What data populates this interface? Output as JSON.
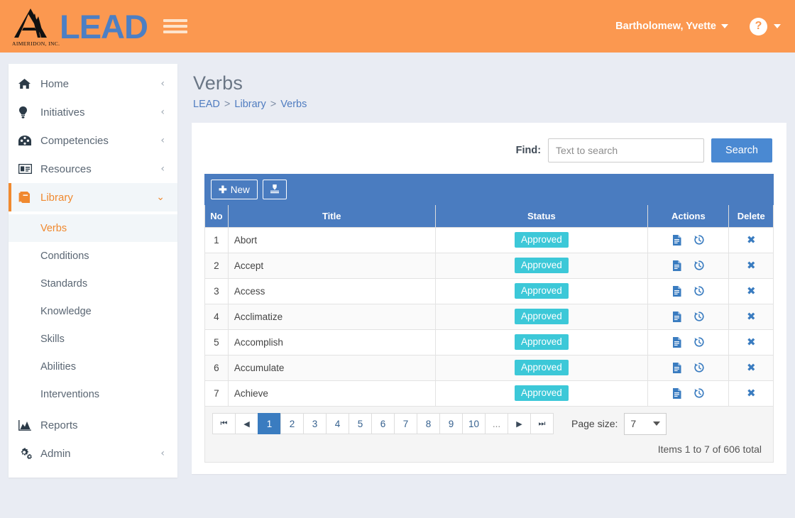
{
  "topbar": {
    "logo_word": "LEAD",
    "logo_sub": "AIMERIDON, INC.",
    "menu_icon": "hamburger-icon",
    "user_name": "Bartholomew, Yvette",
    "help_glyph": "?"
  },
  "sidebar": {
    "items": [
      {
        "label": "Home",
        "icon": "home-icon",
        "chevron": "‹",
        "active": false
      },
      {
        "label": "Initiatives",
        "icon": "lightbulb-icon",
        "chevron": "‹",
        "active": false
      },
      {
        "label": "Competencies",
        "icon": "dashboard-icon",
        "chevron": "‹",
        "active": false
      },
      {
        "label": "Resources",
        "icon": "id-card-icon",
        "chevron": "‹",
        "active": false
      },
      {
        "label": "Library",
        "icon": "book-icon",
        "chevron": "⌄",
        "active": true
      },
      {
        "label": "Reports",
        "icon": "chart-area-icon",
        "chevron": "",
        "active": false
      },
      {
        "label": "Admin",
        "icon": "cogs-icon",
        "chevron": "‹",
        "active": false
      }
    ],
    "sub_items": [
      {
        "label": "Verbs",
        "active": true
      },
      {
        "label": "Conditions",
        "active": false
      },
      {
        "label": "Standards",
        "active": false
      },
      {
        "label": "Knowledge",
        "active": false
      },
      {
        "label": "Skills",
        "active": false
      },
      {
        "label": "Abilities",
        "active": false
      },
      {
        "label": "Interventions",
        "active": false
      }
    ]
  },
  "main": {
    "page_title": "Verbs",
    "breadcrumb": {
      "root": "LEAD",
      "sep1": ">",
      "parent": "Library",
      "sep2": ">",
      "current": "Verbs"
    },
    "search": {
      "label": "Find:",
      "placeholder": "Text to search",
      "value": "",
      "button": "Search"
    },
    "toolbar": {
      "new_label": "New",
      "new_glyph": "✚",
      "export_icon": "download-icon"
    },
    "table": {
      "columns": [
        "No",
        "Title",
        "Status",
        "Actions",
        "Delete"
      ],
      "rows": [
        {
          "no": "1",
          "title": "Abort",
          "status": "Approved"
        },
        {
          "no": "2",
          "title": "Accept",
          "status": "Approved"
        },
        {
          "no": "3",
          "title": "Access",
          "status": "Approved"
        },
        {
          "no": "4",
          "title": "Acclimatize",
          "status": "Approved"
        },
        {
          "no": "5",
          "title": "Accomplish",
          "status": "Approved"
        },
        {
          "no": "6",
          "title": "Accumulate",
          "status": "Approved"
        },
        {
          "no": "7",
          "title": "Achieve",
          "status": "Approved"
        }
      ],
      "row_actions": {
        "detail_icon": "file-text-icon",
        "history_icon": "history-icon",
        "delete_icon": "times-icon",
        "delete_glyph": "✖"
      }
    },
    "pager": {
      "first_glyph": "⏮",
      "prev_glyph": "◀",
      "next_glyph": "▶",
      "last_glyph": "⏭",
      "pages": [
        "1",
        "2",
        "3",
        "4",
        "5",
        "6",
        "7",
        "8",
        "9",
        "10"
      ],
      "ellipsis": "...",
      "active_page": "1",
      "page_size_label": "Page size:",
      "page_size_value": "7",
      "items_total": "Items 1 to 7 of 606 total"
    }
  },
  "colors": {
    "brand_orange": "#fb9850",
    "brand_blue": "#4c7fc4",
    "grid_header_blue": "#4a7cc0",
    "badge_teal": "#3cc8d8",
    "active_orange": "#f0892f"
  }
}
